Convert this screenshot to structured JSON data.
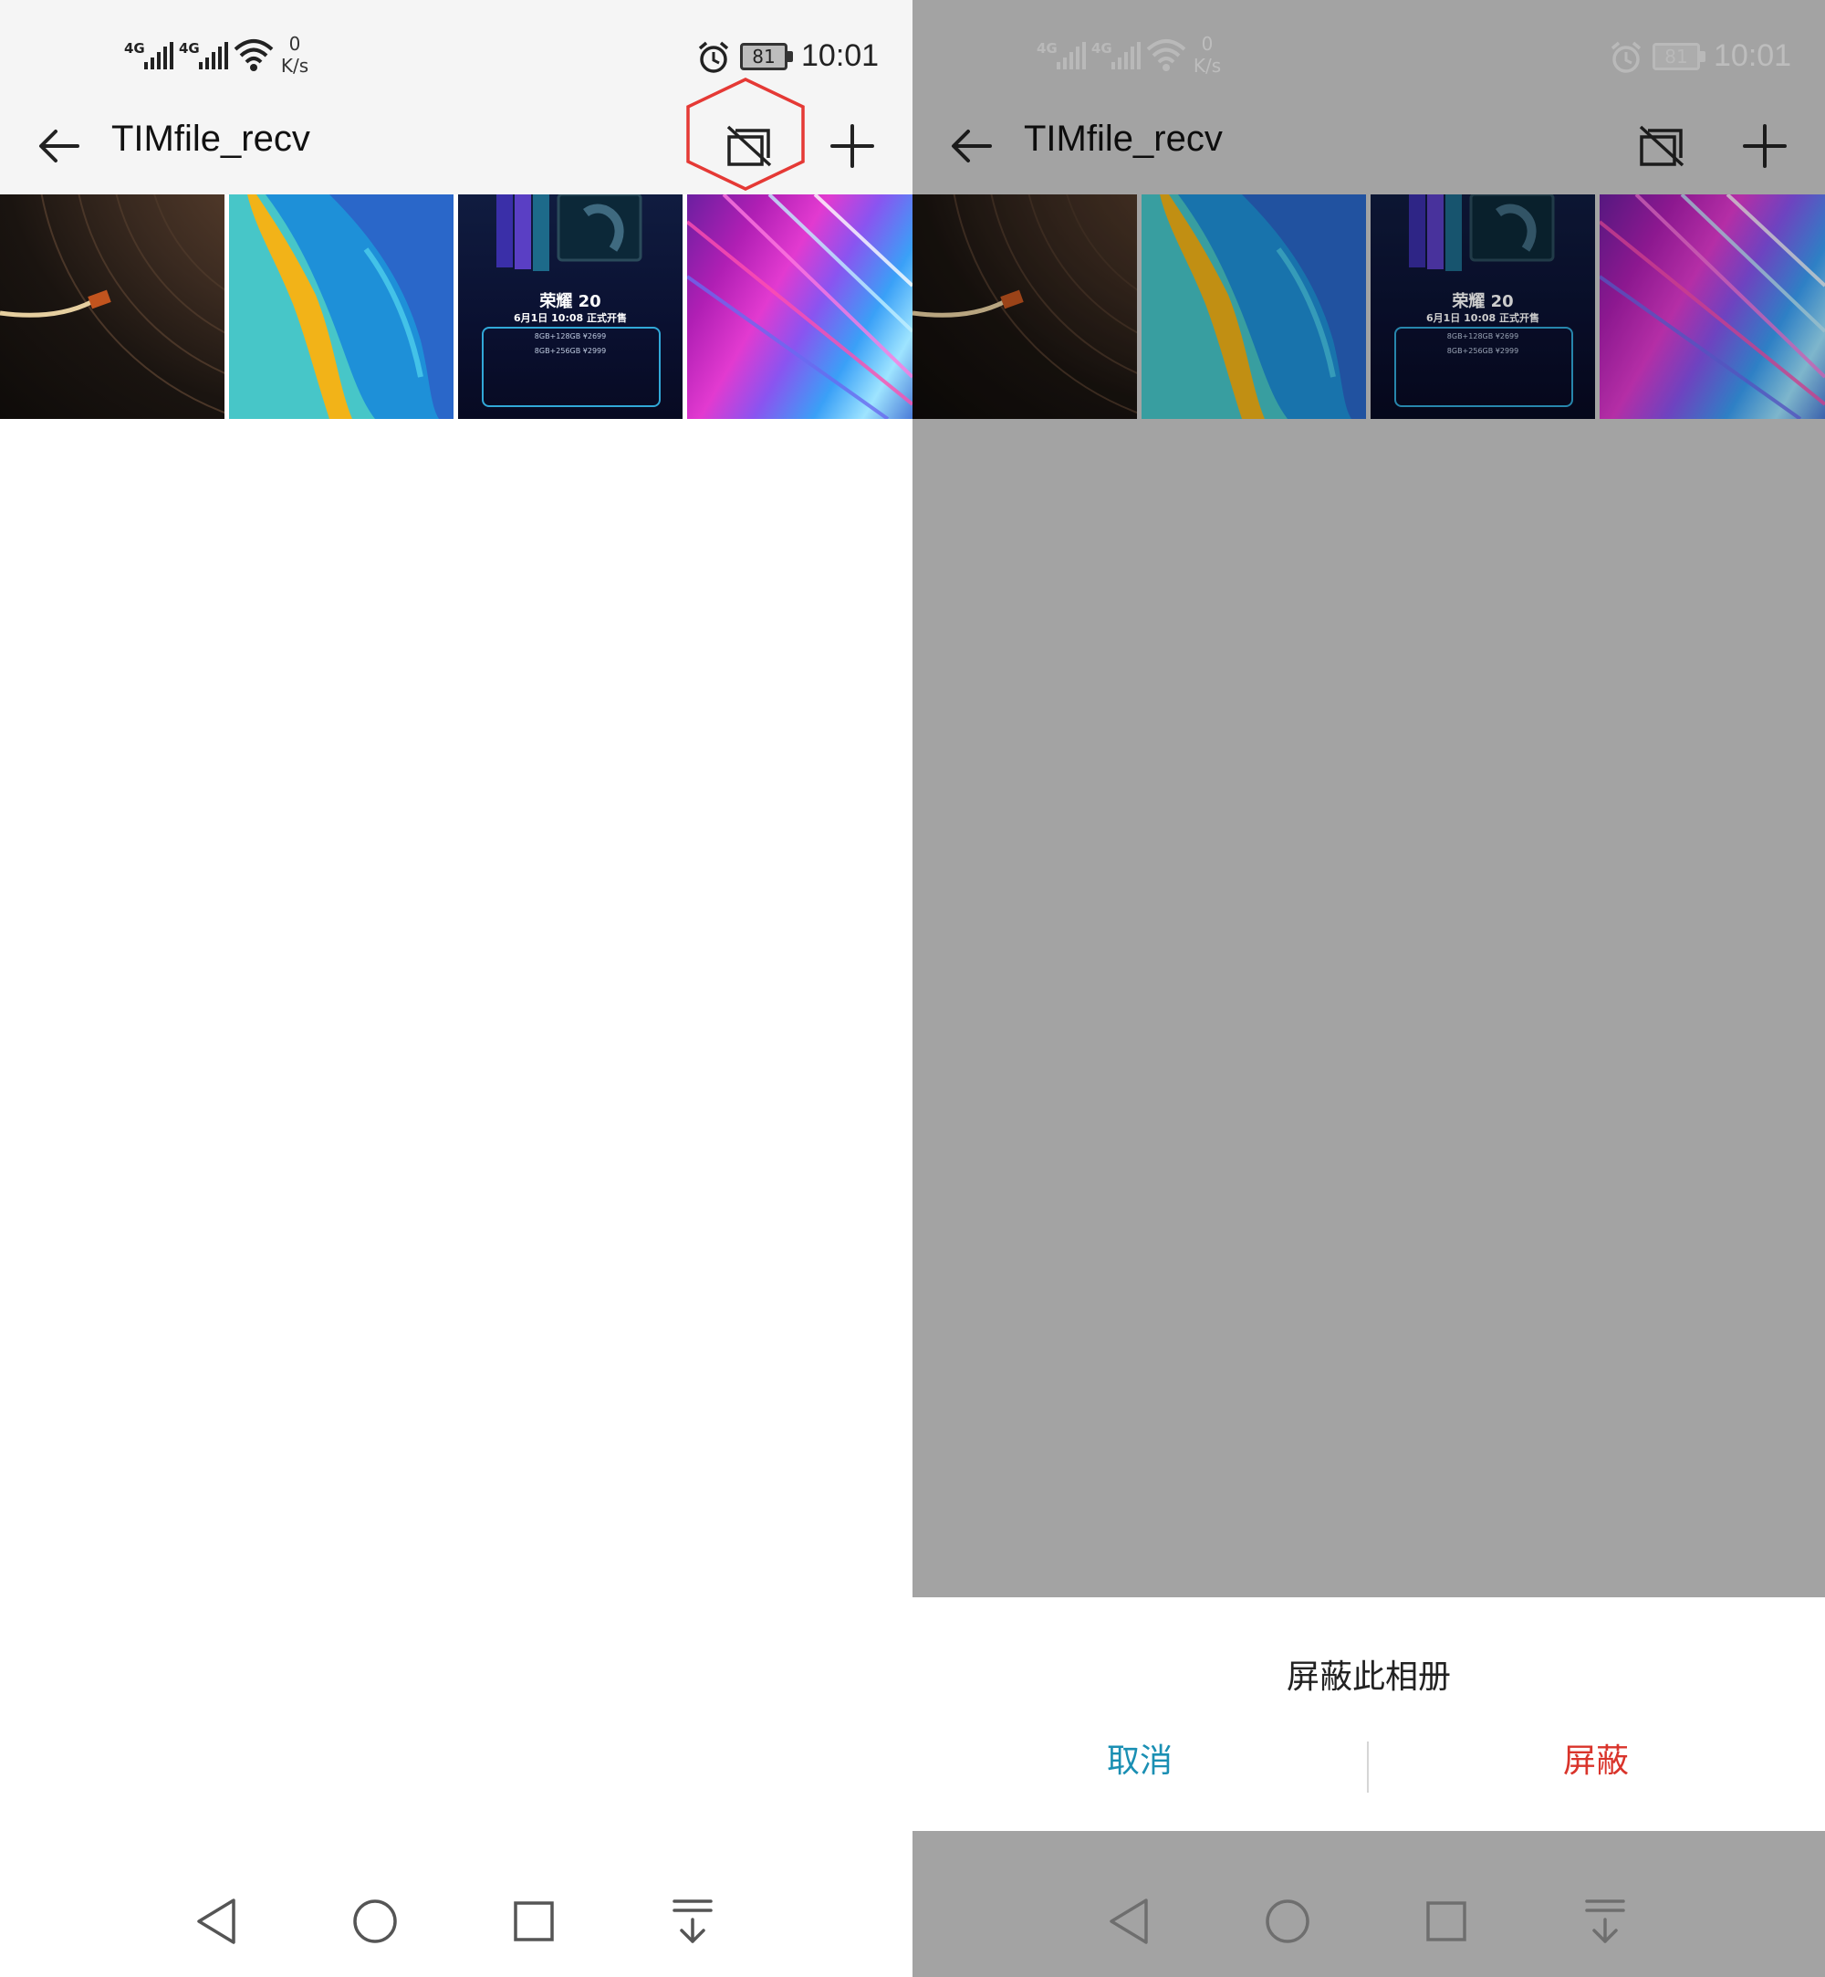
{
  "status": {
    "network1": "4G",
    "network2": "4G",
    "speed_value": "0",
    "speed_unit": "K/s",
    "battery": "81",
    "time": "10:01"
  },
  "toolbar": {
    "title": "TIMfile_recv",
    "back_icon": "arrow-left-icon",
    "hide_icon": "hide-album-icon",
    "add_icon": "plus-icon"
  },
  "photos": [
    {
      "name": "vinyl-record-photo"
    },
    {
      "name": "parrot-feather-photo"
    },
    {
      "name": "honor-20-poster",
      "caption_title": "荣耀 20",
      "caption_date": "6月1日 10:08 正式开售",
      "caption_price1": "8GB+128GB  ¥2699",
      "caption_price2": "8GB+256GB  ¥2999"
    },
    {
      "name": "light-streaks-photo"
    }
  ],
  "dialog": {
    "message": "屏蔽此相册",
    "cancel": "取消",
    "confirm": "屏蔽"
  },
  "colors": {
    "highlight": "#e53935",
    "cancel": "#1a8fb3",
    "confirm": "#d9342b",
    "dim_background": "#cccccc"
  }
}
